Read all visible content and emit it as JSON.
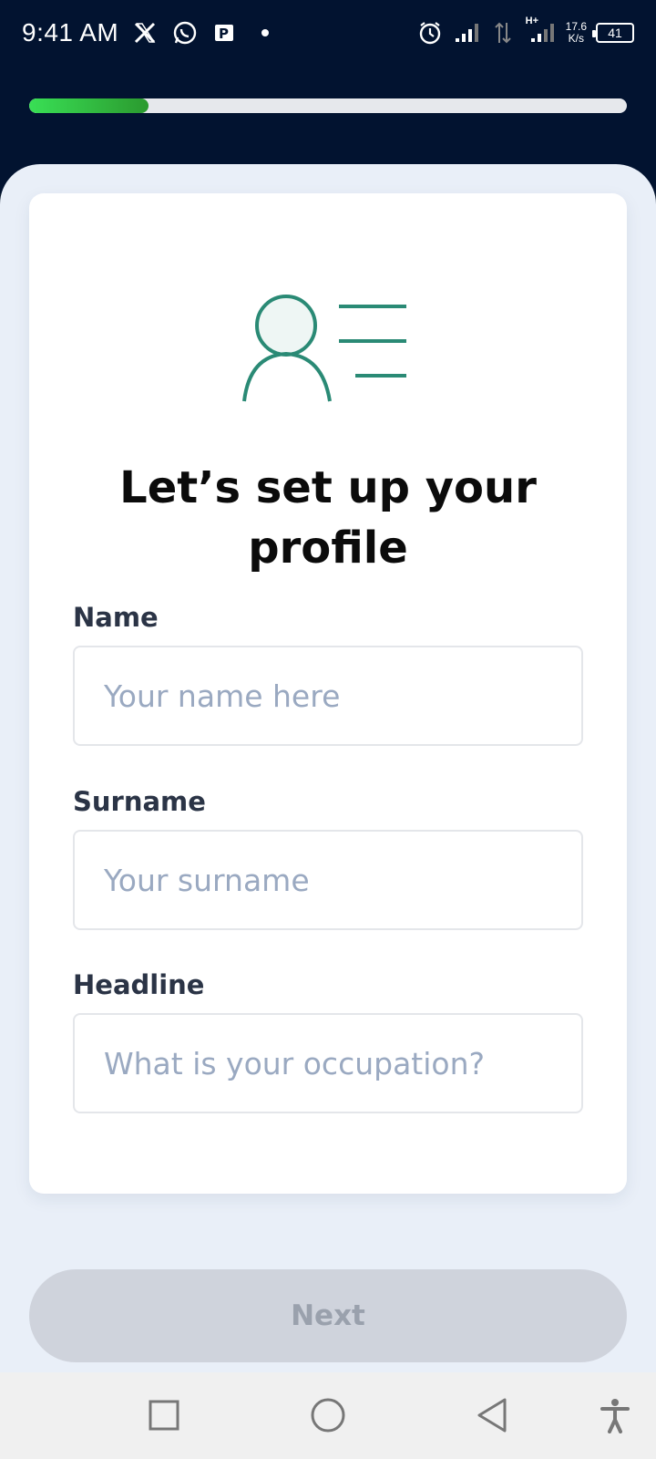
{
  "status_bar": {
    "time": "9:41 AM",
    "net_speed_value": "17.6",
    "net_speed_unit": "K/s",
    "network_type": "H+",
    "battery": "41"
  },
  "progress": {
    "fraction": 0.2
  },
  "card": {
    "title": "Let’s set up your profile",
    "fields": [
      {
        "label": "Name",
        "placeholder": "Your name here",
        "value": ""
      },
      {
        "label": "Surname",
        "placeholder": "Your surname",
        "value": ""
      },
      {
        "label": "Headline",
        "placeholder": "What is your occupation?",
        "value": ""
      }
    ]
  },
  "actions": {
    "next_label": "Next"
  },
  "colors": {
    "header_bg": "#021330",
    "accent_green": "#2a8a75",
    "progress_start": "#39df55",
    "progress_end": "#2b9a2f",
    "button_disabled": "#cfd3dc"
  }
}
